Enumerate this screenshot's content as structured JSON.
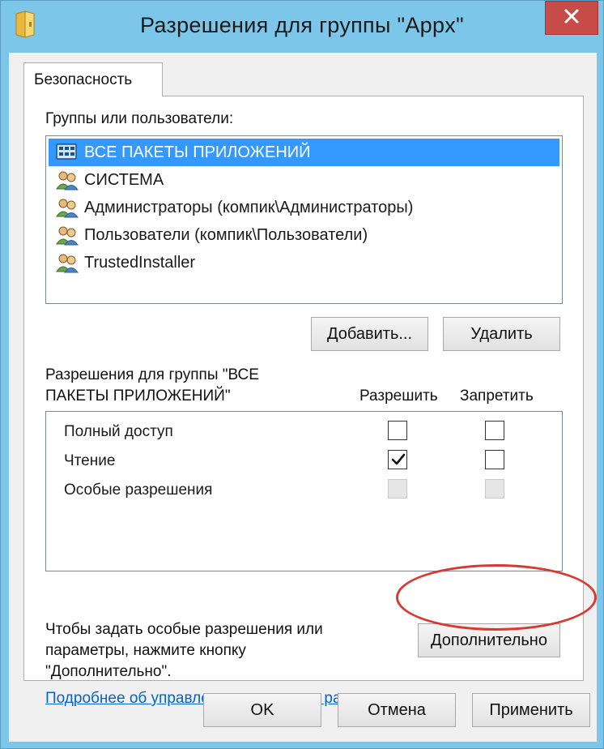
{
  "window": {
    "title": "Разрешения для группы \"Appx\""
  },
  "tabs": [
    {
      "label": "Безопасность",
      "active": true
    }
  ],
  "groups": {
    "label": "Группы или пользователи:",
    "items": [
      {
        "label": "ВСЕ ПАКЕТЫ ПРИЛОЖЕНИЙ",
        "icon": "app-packages-icon",
        "selected": true
      },
      {
        "label": "СИСТЕМА",
        "icon": "users-group-icon",
        "selected": false
      },
      {
        "label": "Администраторы (компик\\Администраторы)",
        "icon": "users-group-icon",
        "selected": false
      },
      {
        "label": "Пользователи (компик\\Пользователи)",
        "icon": "users-group-icon",
        "selected": false
      },
      {
        "label": "TrustedInstaller",
        "icon": "users-group-icon",
        "selected": false
      }
    ],
    "add_label": "Добавить...",
    "remove_label": "Удалить"
  },
  "permissions": {
    "header_line1": "Разрешения для группы \"ВСЕ",
    "header_line2": "ПАКЕТЫ ПРИЛОЖЕНИЙ\"",
    "allow_label": "Разрешить",
    "deny_label": "Запретить",
    "rows": [
      {
        "name": "Полный доступ",
        "allow": false,
        "deny": false,
        "disabled": false
      },
      {
        "name": "Чтение",
        "allow": true,
        "deny": false,
        "disabled": false
      },
      {
        "name": "Особые разрешения",
        "allow": false,
        "deny": false,
        "disabled": true
      }
    ]
  },
  "advanced": {
    "hint_line1": "Чтобы задать особые разрешения или",
    "hint_line2": "параметры, нажмите кнопку",
    "hint_line3": "\"Дополнительно\".",
    "button_label": "Дополнительно"
  },
  "link": {
    "label": "Подробнее об управлении доступом и разрешениях"
  },
  "footer": {
    "ok_label": "OK",
    "cancel_label": "Отмена",
    "apply_label": "Применить"
  },
  "colors": {
    "titlebar": "#7cc6ea",
    "selection": "#3399ff",
    "close_button": "#c74b48",
    "highlight_ellipse": "#d83a32",
    "link": "#0066cc"
  }
}
